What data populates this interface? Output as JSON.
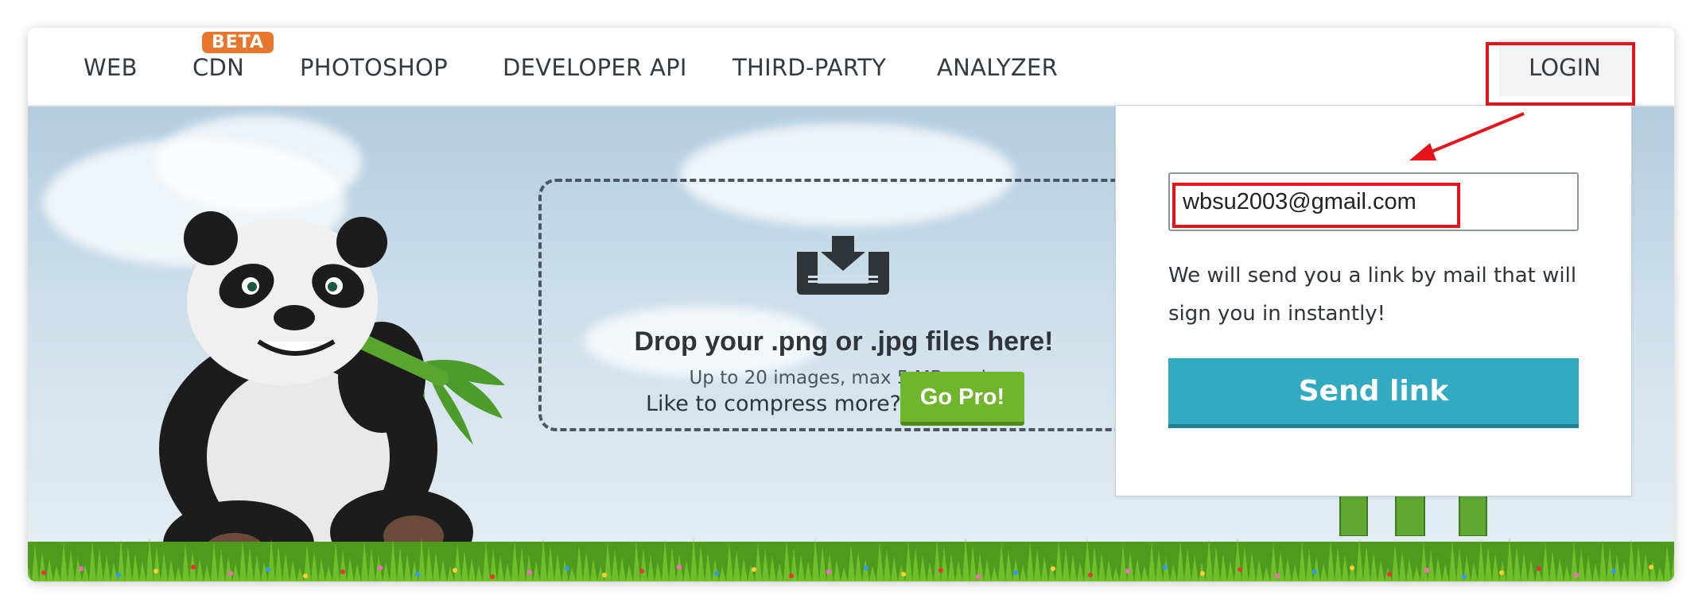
{
  "nav": {
    "items": [
      "WEB",
      "CDN",
      "PHOTOSHOP",
      "DEVELOPER API",
      "THIRD-PARTY",
      "ANALYZER"
    ],
    "cdn_badge": "BETA",
    "login_label": "LOGIN"
  },
  "dropzone": {
    "title": "Drop your .png or .jpg files here!",
    "subtitle": "Up to 20 images, max 5 MB each.",
    "icon": "download-tray-icon"
  },
  "promo": {
    "text": "Like to compress more?",
    "button_label": "Go Pro!"
  },
  "login_popover": {
    "email_value": "wbsu2003@gmail.com",
    "info_text": "We will send you a link by mail that will sign you in instantly!",
    "send_button_label": "Send link"
  },
  "colors": {
    "beta_badge": "#e8772e",
    "go_pro_button": "#6fb62c",
    "send_button": "#31aac2",
    "annotation": "#e4141a"
  }
}
